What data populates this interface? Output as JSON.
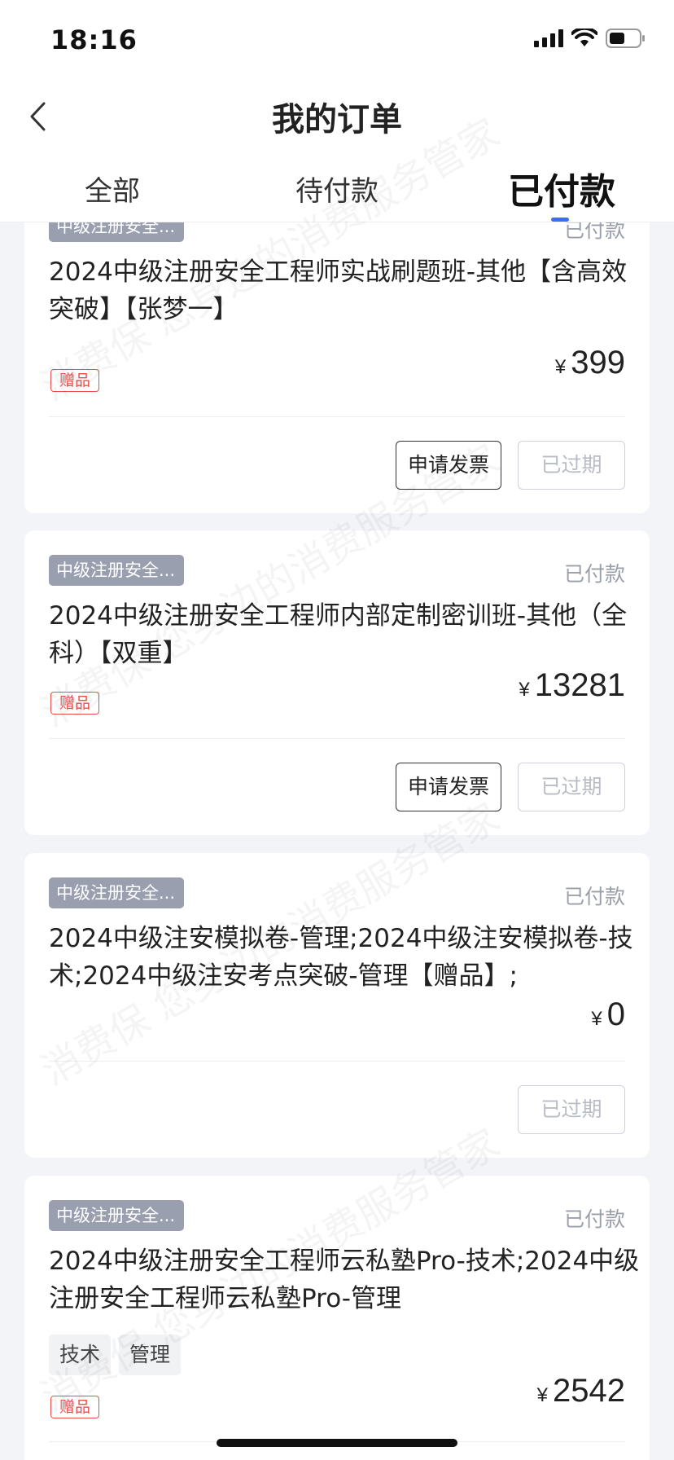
{
  "status_bar": {
    "time": "18:16"
  },
  "nav": {
    "title": "我的订单"
  },
  "tabs": [
    {
      "label": "全部",
      "active": false
    },
    {
      "label": "待付款",
      "active": false
    },
    {
      "label": "已付款",
      "active": true
    }
  ],
  "watermark": {
    "text": "消费保 您身边的消费服务管家"
  },
  "orders": [
    {
      "category": "中级注册安全...",
      "status": "已付款",
      "title": "2024中级注册安全工程师实战刷题班-其他【含高效突破】【张梦一】",
      "gift": "赠品",
      "currency": "¥",
      "price": "399",
      "invoice_button": "申请发票",
      "expired_button": "已过期"
    },
    {
      "category": "中级注册安全...",
      "status": "已付款",
      "title": "2024中级注册安全工程师内部定制密训班-其他（全科）【双重】",
      "gift": "赠品",
      "currency": "¥",
      "price": "13281",
      "invoice_button": "申请发票",
      "expired_button": "已过期"
    },
    {
      "category": "中级注册安全...",
      "status": "已付款",
      "title": "2024中级注安模拟卷-管理;2024中级注安模拟卷-技术;2024中级注安考点突破-管理【赠品】;",
      "currency": "¥",
      "price": "0",
      "expired_button": "已过期"
    },
    {
      "category": "中级注册安全...",
      "status": "已付款",
      "title": "2024中级注册安全工程师云私塾Pro-技术;2024中级注册安全工程师云私塾Pro-管理",
      "tags": [
        "技术",
        "管理"
      ],
      "gift": "赠品",
      "currency": "¥",
      "price": "2542"
    }
  ],
  "colors": {
    "accent": "#3d6df2",
    "gift_red": "#f04b4b",
    "badge_gray": "#9a9fb0",
    "page_bg": "#f3f4f8"
  }
}
